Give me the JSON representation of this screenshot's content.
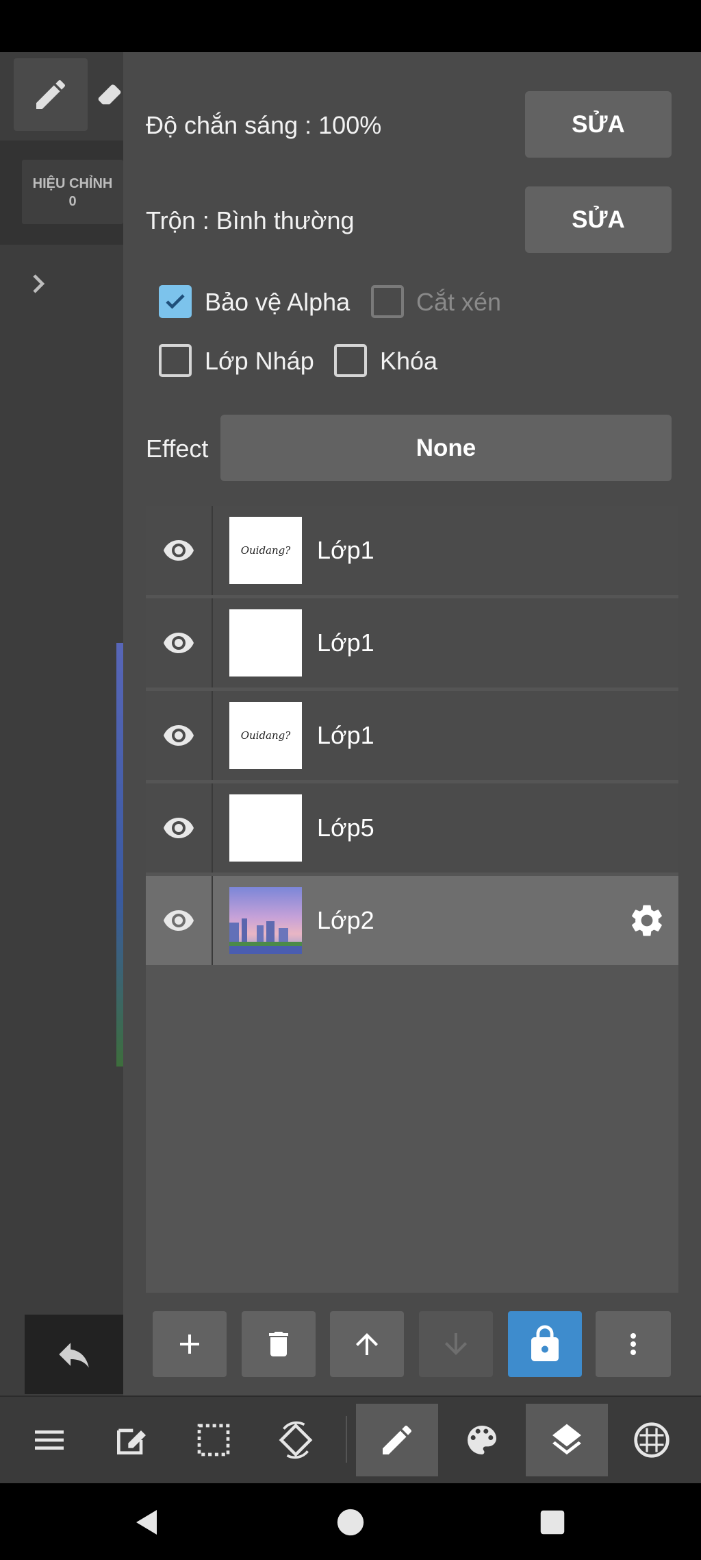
{
  "left": {
    "hieu_chinh_label": "HIỆU CHỈNH",
    "hieu_chinh_value": "0"
  },
  "panel": {
    "opacity_label": "Độ chắn sáng : 100%",
    "opacity_edit": "SỬA",
    "blend_label": "Trộn : Bình thường",
    "blend_edit": "SỬA",
    "checkboxes": [
      {
        "label": "Bảo vệ Alpha",
        "checked": true,
        "enabled": true
      },
      {
        "label": "Cắt xén",
        "checked": false,
        "enabled": false
      },
      {
        "label": "Lớp Nháp",
        "checked": false,
        "enabled": true
      },
      {
        "label": "Khóa",
        "checked": false,
        "enabled": true
      }
    ],
    "effect_label": "Effect",
    "effect_value": "None"
  },
  "layers": [
    {
      "name": "Lớp1",
      "visible": true,
      "thumb": "text",
      "thumb_text": "Ouidang?"
    },
    {
      "name": "Lớp1",
      "visible": true,
      "thumb": "blank"
    },
    {
      "name": "Lớp1",
      "visible": true,
      "thumb": "text",
      "thumb_text": "Ouidang?"
    },
    {
      "name": "Lớp5",
      "visible": true,
      "thumb": "blank"
    },
    {
      "name": "Lớp2",
      "visible": true,
      "thumb": "photo",
      "selected": true
    }
  ],
  "colors": {
    "panel_bg": "#4a4a4a",
    "accent": "#3e8ccd",
    "checkbox_checked": "#7cc3ec"
  },
  "layer_toolbar": [
    "add-icon",
    "delete-icon",
    "arrow-up-icon",
    "arrow-down-icon",
    "lock-icon",
    "more-vert-icon"
  ],
  "bottom_bar": [
    "menu-icon",
    "edit-canvas-icon",
    "selection-icon",
    "rotate-icon",
    "pen-icon",
    "palette-icon",
    "layers-icon",
    "grid-icon"
  ],
  "nav": [
    "back-icon",
    "home-icon",
    "recents-icon"
  ]
}
